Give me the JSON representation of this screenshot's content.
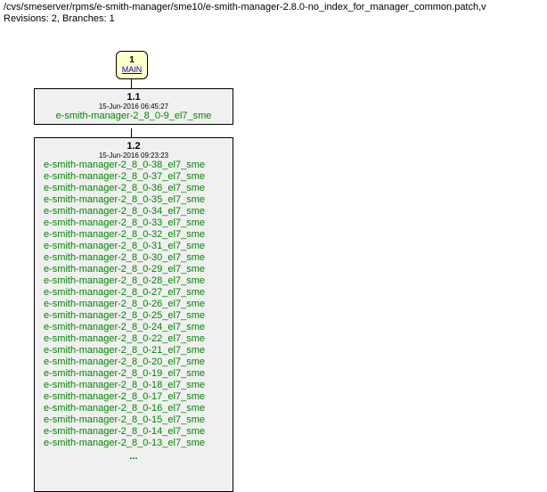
{
  "header": {
    "path": "/cvs/smeserver/rpms/e-smith-manager/sme10/e-smith-manager-2.8.0-no_index_for_manager_common.patch,v",
    "revisions_label": "Revisions: 2, Branches: 1"
  },
  "main": {
    "number": "1",
    "label": "MAIN"
  },
  "node1": {
    "rev": "1.1",
    "date": "15-Jun-2016 06:45:27",
    "tag": "e-smith-manager-2_8_0-9_el7_sme"
  },
  "node2": {
    "rev": "1.2",
    "date": "15-Jun-2016 09:23:23",
    "tags": [
      "e-smith-manager-2_8_0-38_el7_sme",
      "e-smith-manager-2_8_0-37_el7_sme",
      "e-smith-manager-2_8_0-36_el7_sme",
      "e-smith-manager-2_8_0-35_el7_sme",
      "e-smith-manager-2_8_0-34_el7_sme",
      "e-smith-manager-2_8_0-33_el7_sme",
      "e-smith-manager-2_8_0-32_el7_sme",
      "e-smith-manager-2_8_0-31_el7_sme",
      "e-smith-manager-2_8_0-30_el7_sme",
      "e-smith-manager-2_8_0-29_el7_sme",
      "e-smith-manager-2_8_0-28_el7_sme",
      "e-smith-manager-2_8_0-27_el7_sme",
      "e-smith-manager-2_8_0-26_el7_sme",
      "e-smith-manager-2_8_0-25_el7_sme",
      "e-smith-manager-2_8_0-24_el7_sme",
      "e-smith-manager-2_8_0-22_el7_sme",
      "e-smith-manager-2_8_0-21_el7_sme",
      "e-smith-manager-2_8_0-20_el7_sme",
      "e-smith-manager-2_8_0-19_el7_sme",
      "e-smith-manager-2_8_0-18_el7_sme",
      "e-smith-manager-2_8_0-17_el7_sme",
      "e-smith-manager-2_8_0-16_el7_sme",
      "e-smith-manager-2_8_0-15_el7_sme",
      "e-smith-manager-2_8_0-14_el7_sme",
      "e-smith-manager-2_8_0-13_el7_sme"
    ],
    "ellipsis": "..."
  }
}
